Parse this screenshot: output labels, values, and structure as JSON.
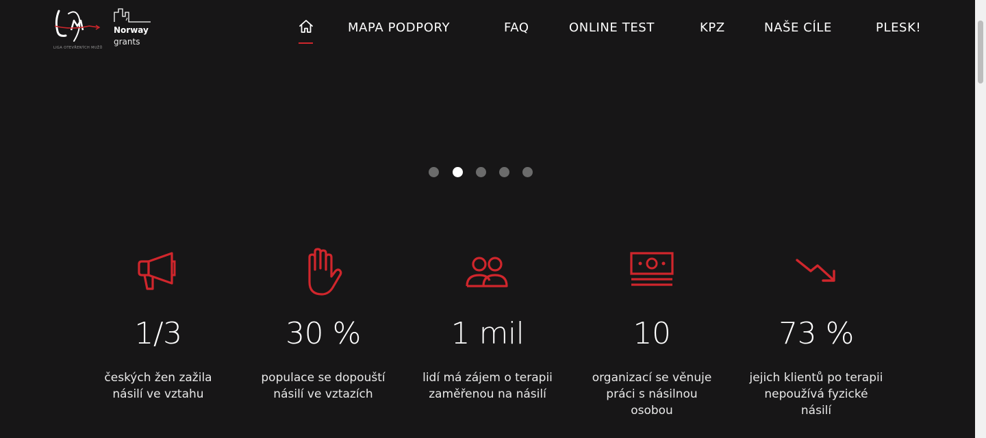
{
  "header": {
    "logo_lom_tagline": "LIGA OTEVŘENÝCH MUŽŮ",
    "logo_norway_line1": "Norway",
    "logo_norway_line2": "grants"
  },
  "nav": {
    "home_icon": "home-icon",
    "items": [
      {
        "label": "MAPA PODPORY"
      },
      {
        "label": "FAQ"
      },
      {
        "label": "ONLINE TEST"
      },
      {
        "label": "KPZ"
      },
      {
        "label": "NAŠE CÍLE"
      },
      {
        "label": "PLESK!"
      }
    ],
    "active_color": "#d0262c"
  },
  "carousel": {
    "dot_count": 5,
    "active_index": 1
  },
  "stats": [
    {
      "icon": "megaphone-icon",
      "value": "1/3",
      "desc": "českých žen zažila násilí ve vztahu"
    },
    {
      "icon": "stop-hand-icon",
      "value": "30 %",
      "desc": "populace se dopouští násilí ve vztazích"
    },
    {
      "icon": "people-icon",
      "value": "1 mil",
      "desc": "lidí má zájem o terapii zaměřenou na násilí"
    },
    {
      "icon": "money-icon",
      "value": "10",
      "desc": "organizací se věnuje práci s násilnou osobou"
    },
    {
      "icon": "trend-down-icon",
      "value": "73 %",
      "desc": "jejich klientů po terapii nepoužívá fyzické násilí"
    }
  ],
  "colors": {
    "background": "#171617",
    "accent": "#d0262c",
    "text": "#ffffff"
  }
}
